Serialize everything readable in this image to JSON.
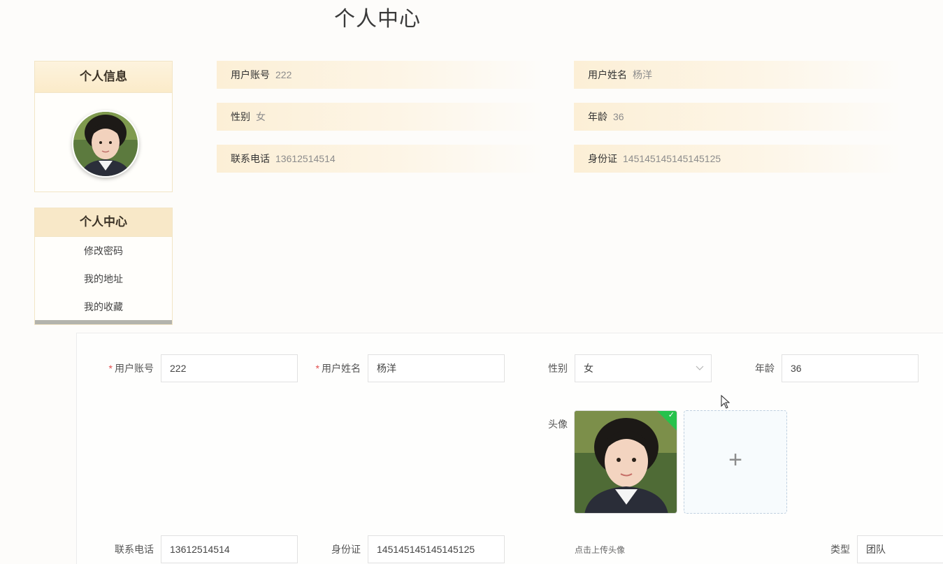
{
  "page_title": "个人中心",
  "sidebar": {
    "info_title": "个人信息",
    "center_title": "个人中心",
    "menu": [
      "修改密码",
      "我的地址",
      "我的收藏"
    ]
  },
  "profile": {
    "account_label": "用户账号",
    "account": "222",
    "name_label": "用户姓名",
    "name": "杨洋",
    "gender_label": "性别",
    "gender": "女",
    "age_label": "年龄",
    "age": "36",
    "phone_label": "联系电话",
    "phone": "13612514514",
    "id_label": "身份证",
    "id_card": "145145145145145125"
  },
  "form": {
    "account_label": "用户账号",
    "account": "222",
    "name_label": "用户姓名",
    "name": "杨洋",
    "gender_label": "性别",
    "gender": "女",
    "age_label": "年龄",
    "age": "36",
    "avatar_label": "头像",
    "upload_plus": "+",
    "upload_hint": "点击上传头像",
    "phone_label": "联系电话",
    "phone": "13612514514",
    "id_label": "身份证",
    "id_card": "145145145145145125",
    "type_label": "类型",
    "type": "团队"
  },
  "colors": {
    "accent": "#f8e8c8",
    "required": "#e34d4d",
    "success": "#27c24c"
  }
}
